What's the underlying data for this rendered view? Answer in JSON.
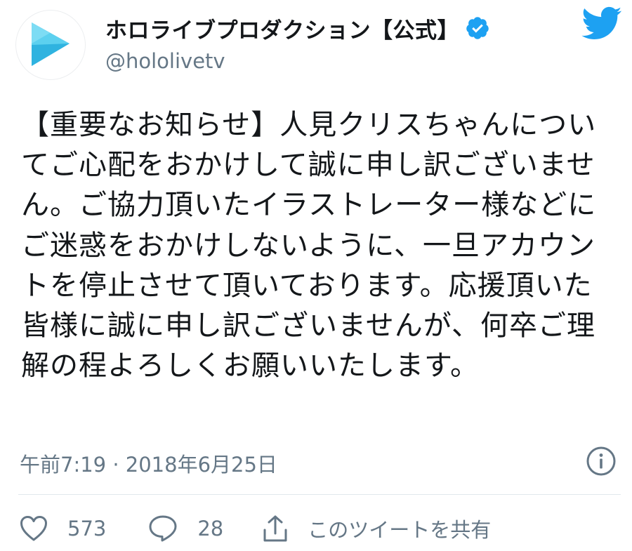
{
  "header": {
    "display_name": "ホロライブプロダクション【公式】",
    "handle": "@hololivetv",
    "verified_icon": "verified-badge-icon",
    "brand_icon": "twitter-bird-icon",
    "avatar_icon": "play-logo-icon"
  },
  "tweet": {
    "text": "【重要なお知らせ】人見クリスちゃんについてご心配をおかけして誠に申し訳ございません。ご協力頂いたイラストレーター様などにご迷惑をおかけしないように、一旦アカウントを停止させて頂いております。応援頂いた皆様に誠に申し訳ございませんが、何卒ご理解の程よろしくお願いいたします。",
    "timestamp": "午前7:19 · 2018年6月25日"
  },
  "actions": {
    "like_count": "573",
    "reply_count": "28",
    "share_label": "このツイートを共有"
  },
  "colors": {
    "twitter_blue": "#1da1f2",
    "text_primary": "#14171a",
    "text_secondary": "#657786",
    "avatar_cyan": "#45c3e8"
  }
}
